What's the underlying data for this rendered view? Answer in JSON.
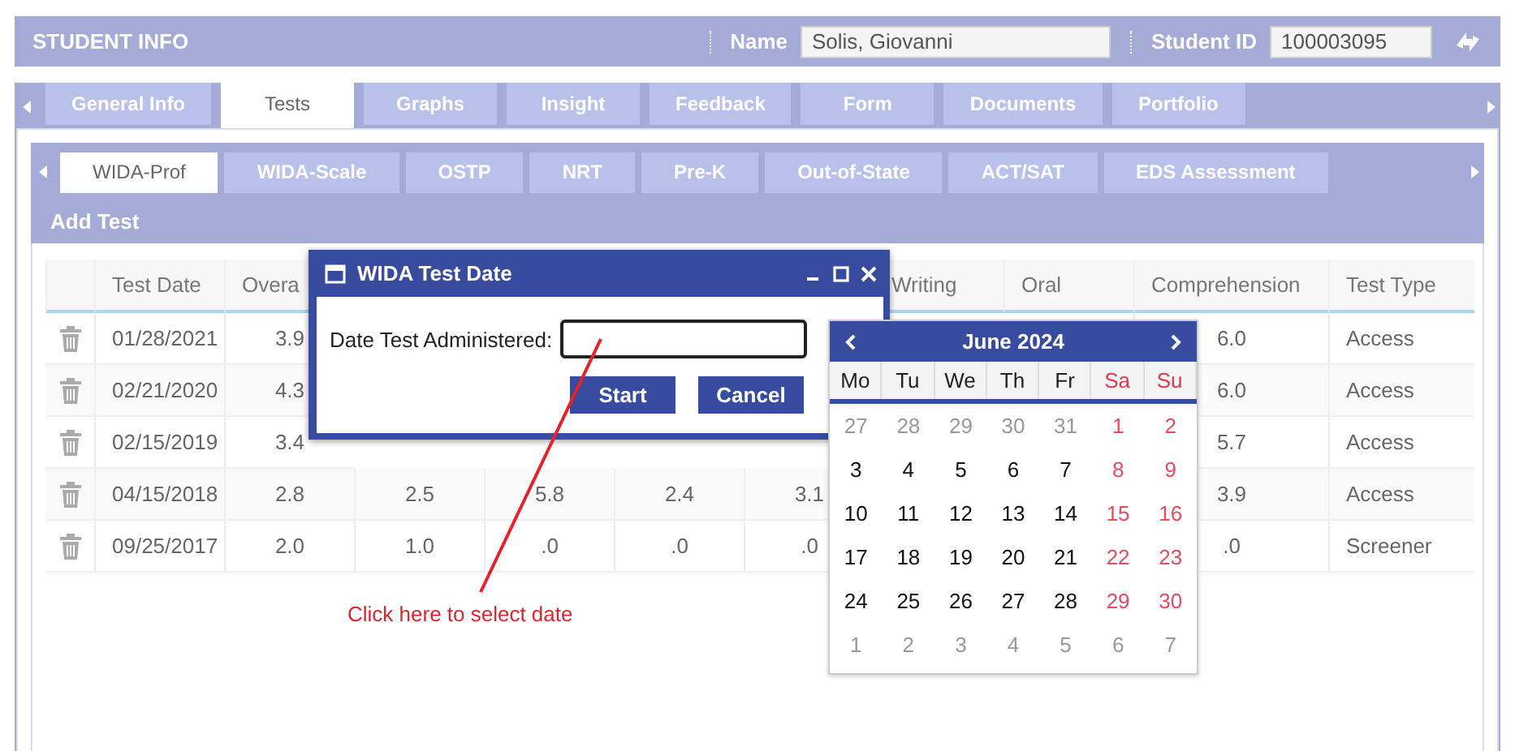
{
  "header": {
    "title": "STUDENT INFO",
    "name_label": "Name",
    "name_value": "Solis, Giovanni",
    "id_label": "Student ID",
    "id_value": "100003095"
  },
  "tabs": [
    {
      "label": "General Info",
      "selected": false
    },
    {
      "label": "Tests",
      "selected": true
    },
    {
      "label": "Graphs",
      "selected": false
    },
    {
      "label": "Insight",
      "selected": false
    },
    {
      "label": "Feedback",
      "selected": false
    },
    {
      "label": "Form",
      "selected": false
    },
    {
      "label": "Documents",
      "selected": false
    },
    {
      "label": "Portfolio",
      "selected": false
    }
  ],
  "subtabs": [
    {
      "label": "WIDA-Prof",
      "selected": true
    },
    {
      "label": "WIDA-Scale",
      "selected": false
    },
    {
      "label": "OSTP",
      "selected": false
    },
    {
      "label": "NRT",
      "selected": false
    },
    {
      "label": "Pre-K",
      "selected": false
    },
    {
      "label": "Out-of-State",
      "selected": false
    },
    {
      "label": "ACT/SAT",
      "selected": false
    },
    {
      "label": "EDS Assessment",
      "selected": false
    }
  ],
  "add_test": "Add Test",
  "table": {
    "columns": {
      "test_date": "Test Date",
      "overall": "Overa",
      "writing": "Writing",
      "oral": "Oral",
      "comprehension": "Comprehension",
      "test_type": "Test Type"
    },
    "rows": [
      {
        "test_date": "01/28/2021",
        "overall": "3.9",
        "comprehension": "6.0",
        "test_type": "Access"
      },
      {
        "test_date": "02/21/2020",
        "overall": "4.3",
        "comprehension": "6.0",
        "test_type": "Access"
      },
      {
        "test_date": "02/15/2019",
        "overall": "3.4",
        "comprehension": "5.7",
        "test_type": "Access"
      },
      {
        "test_date": "04/15/2018",
        "overall": "2.8",
        "column_3": "2.5",
        "column_4": "5.8",
        "column_5": "2.4",
        "column_6": "3.1",
        "comprehension": "3.9",
        "test_type": "Access"
      },
      {
        "test_date": "09/25/2017",
        "overall": "2.0",
        "column_3": "1.0",
        "column_4": ".0",
        "column_5": ".0",
        "column_6": ".0",
        "comprehension": ".0",
        "test_type": "Screener"
      }
    ]
  },
  "dialog": {
    "title": "WIDA Test Date",
    "field_label": "Date Test Administered:",
    "buttons": [
      "Start",
      "Cancel"
    ]
  },
  "calendar": {
    "month": "June 2024",
    "weekdays": [
      {
        "label": "Mo",
        "weekend": false
      },
      {
        "label": "Tu",
        "weekend": false
      },
      {
        "label": "We",
        "weekend": false
      },
      {
        "label": "Th",
        "weekend": false
      },
      {
        "label": "Fr",
        "weekend": false
      },
      {
        "label": "Sa",
        "weekend": true
      },
      {
        "label": "Su",
        "weekend": true
      }
    ],
    "weeks": [
      [
        {
          "day": "27",
          "outside": true
        },
        {
          "day": "28",
          "outside": true
        },
        {
          "day": "29",
          "outside": true
        },
        {
          "day": "30",
          "outside": true
        },
        {
          "day": "31",
          "outside": true
        },
        {
          "day": "1",
          "outside": false,
          "weekend": true
        },
        {
          "day": "2",
          "outside": false,
          "weekend": true
        }
      ],
      [
        {
          "day": "3",
          "outside": false,
          "weekend": false
        },
        {
          "day": "4",
          "outside": false,
          "weekend": false
        },
        {
          "day": "5",
          "outside": false,
          "weekend": false
        },
        {
          "day": "6",
          "outside": false,
          "weekend": false
        },
        {
          "day": "7",
          "outside": false,
          "weekend": false
        },
        {
          "day": "8",
          "outside": false,
          "weekend": true
        },
        {
          "day": "9",
          "outside": false,
          "weekend": true
        }
      ],
      [
        {
          "day": "10",
          "outside": false,
          "weekend": false
        },
        {
          "day": "11",
          "outside": false,
          "weekend": false
        },
        {
          "day": "12",
          "outside": false,
          "weekend": false
        },
        {
          "day": "13",
          "outside": false,
          "weekend": false
        },
        {
          "day": "14",
          "outside": false,
          "weekend": false
        },
        {
          "day": "15",
          "outside": false,
          "weekend": true
        },
        {
          "day": "16",
          "outside": false,
          "weekend": true
        }
      ],
      [
        {
          "day": "17",
          "outside": false,
          "weekend": false
        },
        {
          "day": "18",
          "outside": false,
          "weekend": false
        },
        {
          "day": "19",
          "outside": false,
          "weekend": false
        },
        {
          "day": "20",
          "outside": false,
          "weekend": false
        },
        {
          "day": "21",
          "outside": false,
          "weekend": false
        },
        {
          "day": "22",
          "outside": false,
          "weekend": true
        },
        {
          "day": "23",
          "outside": false,
          "weekend": true
        }
      ],
      [
        {
          "day": "24",
          "outside": false,
          "weekend": false
        },
        {
          "day": "25",
          "outside": false,
          "weekend": false
        },
        {
          "day": "26",
          "outside": false,
          "weekend": false
        },
        {
          "day": "27",
          "outside": false,
          "weekend": false
        },
        {
          "day": "28",
          "outside": false,
          "weekend": false
        },
        {
          "day": "29",
          "outside": false,
          "weekend": true
        },
        {
          "day": "30",
          "outside": false,
          "weekend": true
        }
      ],
      [
        {
          "day": "1",
          "outside": true
        },
        {
          "day": "2",
          "outside": true
        },
        {
          "day": "3",
          "outside": true
        },
        {
          "day": "4",
          "outside": true
        },
        {
          "day": "5",
          "outside": true
        },
        {
          "day": "6",
          "outside": true
        },
        {
          "day": "7",
          "outside": true
        }
      ]
    ]
  },
  "annotation": "Click here to select date"
}
